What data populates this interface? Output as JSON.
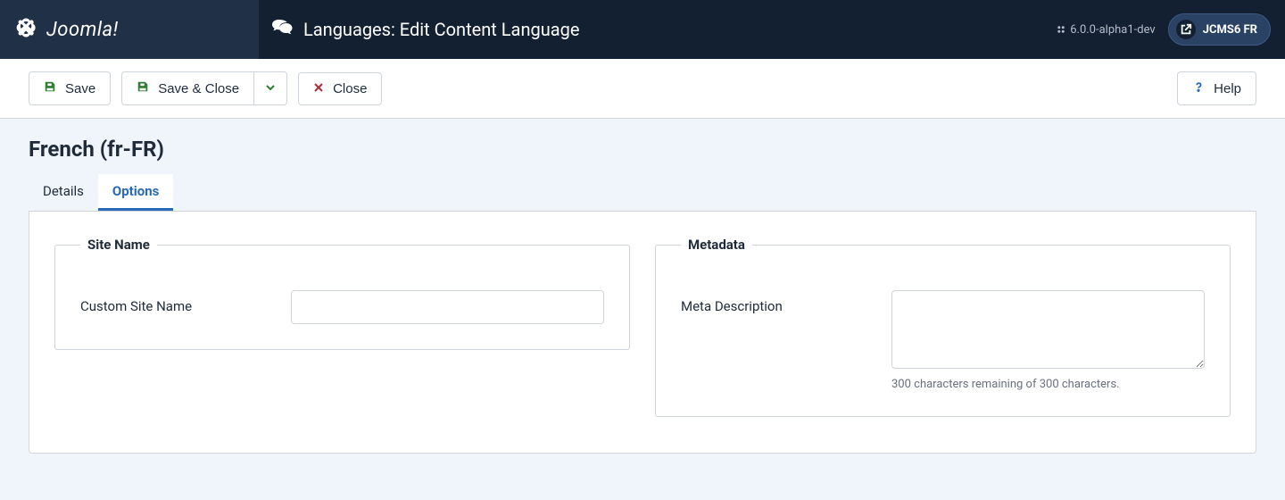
{
  "header": {
    "brand": "Joomla!",
    "page_title": "Languages: Edit Content Language",
    "version": "6.0.0-alpha1-dev",
    "site_name": "JCMS6 FR"
  },
  "toolbar": {
    "save": "Save",
    "save_close": "Save & Close",
    "close": "Close",
    "help": "Help"
  },
  "content": {
    "title": "French (fr-FR)",
    "tabs": {
      "details": "Details",
      "options": "Options"
    },
    "fieldsets": {
      "site_name": {
        "legend": "Site Name",
        "fields": {
          "custom_site_name": {
            "label": "Custom Site Name",
            "value": ""
          }
        }
      },
      "metadata": {
        "legend": "Metadata",
        "fields": {
          "meta_description": {
            "label": "Meta Description",
            "value": "",
            "help": "300 characters remaining of 300 characters."
          }
        }
      }
    }
  }
}
